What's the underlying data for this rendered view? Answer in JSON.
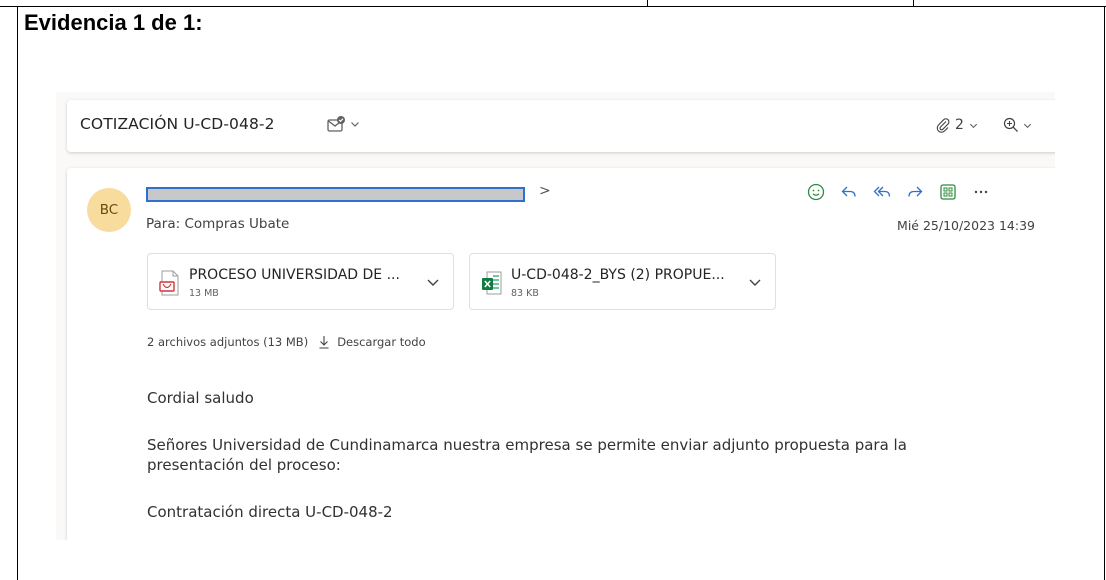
{
  "document": {
    "evidence_title": "Evidencia 1 de 1:"
  },
  "email": {
    "subject": "COTIZACIÓN U-CD-048-2",
    "attachment_count": "2",
    "sender_initials": "BC",
    "sender_suffix": ">",
    "to_line": "Para:  Compras Ubate",
    "date": "Mié 25/10/2023 14:39",
    "attachments": [
      {
        "name": "PROCESO UNIVERSIDAD DE ...",
        "size": "13 MB",
        "type": "pdf-icon"
      },
      {
        "name": "U-CD-048-2_BYS (2) PROPUE...",
        "size": "83 KB",
        "type": "excel-icon"
      }
    ],
    "attachments_summary": "2 archivos adjuntos (13 MB)",
    "download_all": "Descargar todo",
    "body": {
      "greeting": "Cordial saludo",
      "paragraph": "Señores Universidad de Cundinamarca nuestra empresa se permite enviar adjunto propuesta para la presentación del proceso:",
      "line3": "Contratación directa U-CD-048-2"
    }
  },
  "colors": {
    "avatar_bg": "#f7dc9e",
    "action_green": "#2e8b3e",
    "action_blue": "#2f6fd0"
  }
}
